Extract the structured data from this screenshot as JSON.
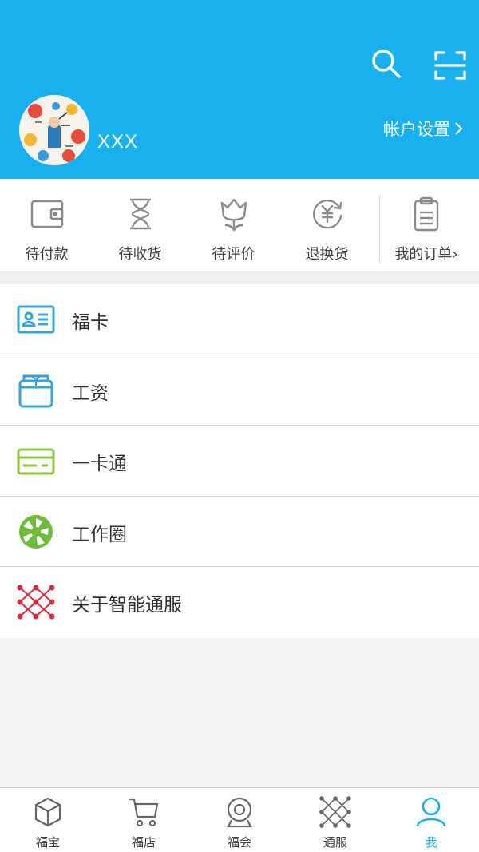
{
  "header": {
    "username": "XXX",
    "account_settings": "帐户设置"
  },
  "orders": [
    {
      "label": "待付款",
      "icon": "wallet-icon"
    },
    {
      "label": "待收货",
      "icon": "hourglass-icon"
    },
    {
      "label": "待评价",
      "icon": "flower-icon"
    },
    {
      "label": "退换货",
      "icon": "yuan-return-icon"
    },
    {
      "label": "我的订单",
      "icon": "clipboard-icon"
    }
  ],
  "menu": [
    {
      "label": "福卡",
      "icon": "id-card-icon"
    },
    {
      "label": "工资",
      "icon": "wallet-yuan-icon"
    },
    {
      "label": "一卡通",
      "icon": "card-icon"
    },
    {
      "label": "工作圈",
      "icon": "aperture-icon"
    },
    {
      "label": "关于智能通服",
      "icon": "network-icon"
    }
  ],
  "tabs": [
    {
      "label": "福宝",
      "icon": "cube-icon"
    },
    {
      "label": "福店",
      "icon": "cart-icon"
    },
    {
      "label": "福会",
      "icon": "webcam-icon"
    },
    {
      "label": "通服",
      "icon": "network-icon"
    },
    {
      "label": "我",
      "icon": "user-icon",
      "active": true
    }
  ],
  "colors": {
    "brand": "#19b0f0",
    "menu_blue": "#3aa3d6",
    "menu_green": "#8cc63f",
    "menu_red": "#d12f3f"
  }
}
